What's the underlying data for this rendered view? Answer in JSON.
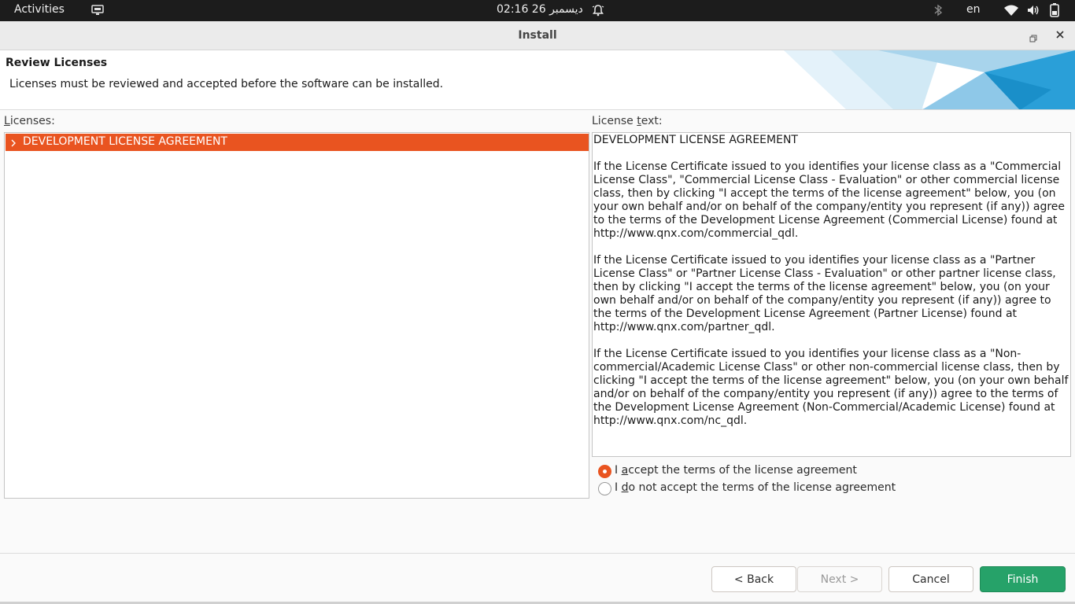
{
  "topbar": {
    "activities": "Activities",
    "clock": "02:16 26 ديسمبر",
    "language": "en",
    "icons": [
      "tray-app-icon",
      "notification-bell-icon",
      "bluetooth-icon",
      "wifi-icon",
      "volume-icon",
      "battery-icon"
    ]
  },
  "window": {
    "title": "Install",
    "controls": [
      "restore-icon",
      "close-icon"
    ]
  },
  "page": {
    "heading": "Review Licenses",
    "description": "Licenses must be reviewed and accepted before the software can be installed."
  },
  "licenses": {
    "label_access": "L",
    "label_rest": "icenses:",
    "items": [
      {
        "name": "DEVELOPMENT LICENSE AGREEMENT",
        "selected": true
      }
    ]
  },
  "license_text": {
    "label_pre": "License ",
    "label_access": "t",
    "label_post": "ext:",
    "title": "DEVELOPMENT LICENSE AGREEMENT",
    "paragraphs": [
      "If the License Certificate issued to you identifies your license class as a \"Commercial License Class\", \"Commercial License Class - Evaluation\" or other commercial license class, then by clicking \"I accept the terms of the license agreement\" below, you (on your own behalf and/or on behalf of the company/entity you represent (if any)) agree to the terms of the Development License Agreement (Commercial License) found at http://www.qnx.com/commercial_qdl.",
      "If the License Certificate issued to you identifies your license class as a \"Partner License Class\" or \"Partner License Class - Evaluation\" or other partner license class, then by clicking \"I accept the terms of the license agreement\" below, you (on your own behalf and/or on behalf of the company/entity you represent (if any)) agree to the terms of the Development License Agreement (Partner License) found at http://www.qnx.com/partner_qdl.",
      "If the License Certificate issued to you identifies your license class as a \"Non-commercial/Academic License Class\" or other non-commercial license class, then by clicking \"I accept the terms of the license agreement\" below, you (on your own behalf and/or on behalf of the company/entity you represent (if any)) agree to the terms of the Development License Agreement (Non-Commercial/Academic License) found at http://www.qnx.com/nc_qdl."
    ]
  },
  "acceptance": {
    "accept": {
      "pre": "I ",
      "access": "a",
      "post": "ccept the terms of the license agreement",
      "selected": true
    },
    "decline": {
      "pre": "I ",
      "access": "d",
      "post": "o not accept the terms of the license agreement",
      "selected": false
    }
  },
  "buttons": {
    "back": "< Back",
    "next": "Next >",
    "cancel": "Cancel",
    "finish": "Finish"
  },
  "colors": {
    "accent": "#e95420",
    "finish": "#26a269",
    "topbar": "#1c1c1c"
  }
}
